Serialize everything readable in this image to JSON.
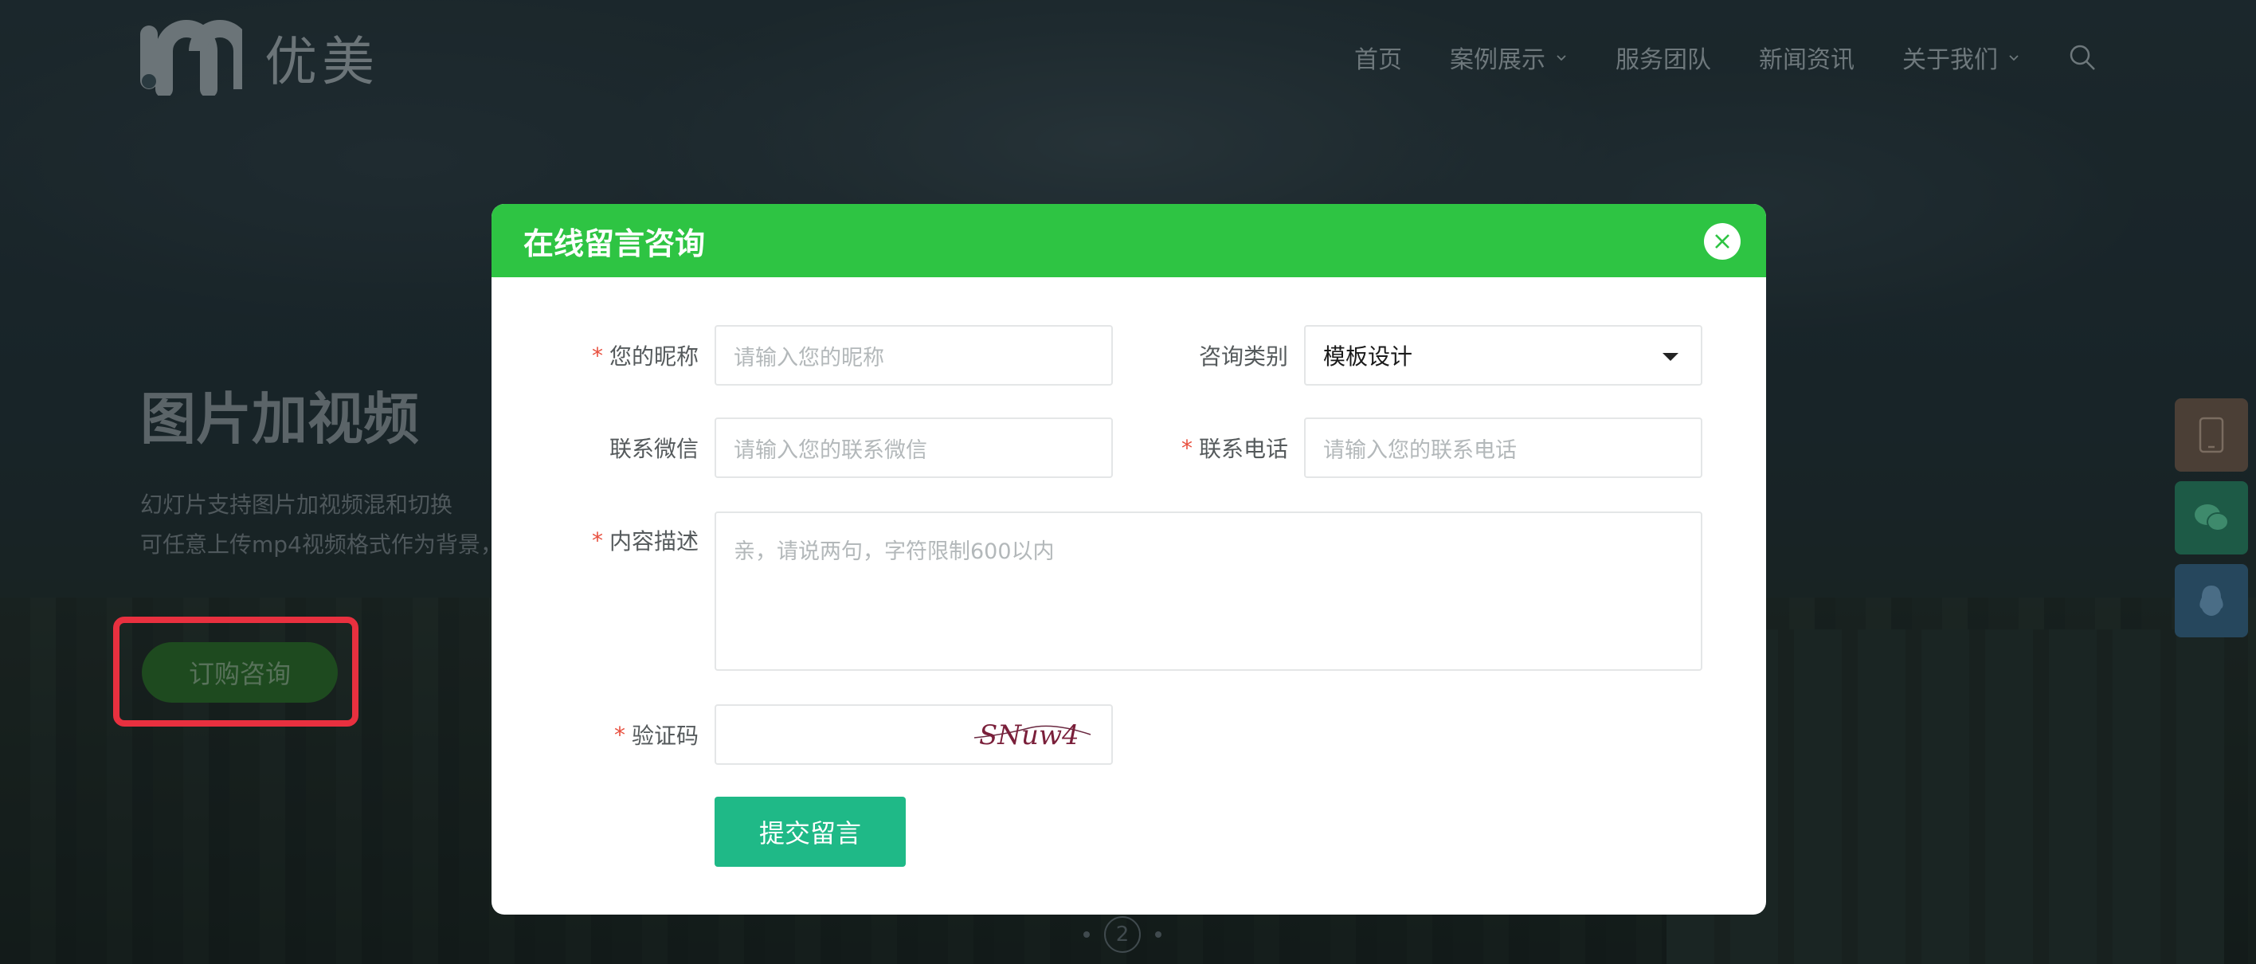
{
  "header": {
    "logo_text": "优美",
    "nav": [
      {
        "label": "首页",
        "has_dropdown": false
      },
      {
        "label": "案例展示",
        "has_dropdown": true
      },
      {
        "label": "服务团队",
        "has_dropdown": false
      },
      {
        "label": "新闻资讯",
        "has_dropdown": false
      },
      {
        "label": "关于我们",
        "has_dropdown": true
      }
    ]
  },
  "hero": {
    "title": "图片加视频",
    "line1": "幻灯片支持图片加视频混和切换",
    "line2": "可任意上传mp4视频格式作为背景，",
    "button_label": "订购咨询"
  },
  "pager": {
    "current": "2"
  },
  "modal": {
    "title": "在线留言咨询",
    "fields": {
      "nickname": {
        "label": "您的昵称",
        "required": true,
        "placeholder": "请输入您的昵称"
      },
      "category": {
        "label": "咨询类别",
        "required": false,
        "value": "模板设计"
      },
      "wechat": {
        "label": "联系微信",
        "required": false,
        "placeholder": "请输入您的联系微信"
      },
      "phone": {
        "label": "联系电话",
        "required": true,
        "placeholder": "请输入您的联系电话"
      },
      "content": {
        "label": "内容描述",
        "required": true,
        "placeholder": "亲，请说两句，字符限制600以内"
      },
      "captcha": {
        "label": "验证码",
        "required": true,
        "image_text": "SNuw4"
      }
    },
    "submit_label": "提交留言"
  },
  "colors": {
    "modal_header": "#2ec443",
    "submit": "#1fb987",
    "required_star": "#e8503f",
    "highlight": "#e8303f"
  },
  "icons": {
    "float_phone": "phone-icon",
    "float_wechat": "wechat-icon",
    "float_qq": "qq-icon",
    "close": "close-icon",
    "search": "search-icon"
  }
}
